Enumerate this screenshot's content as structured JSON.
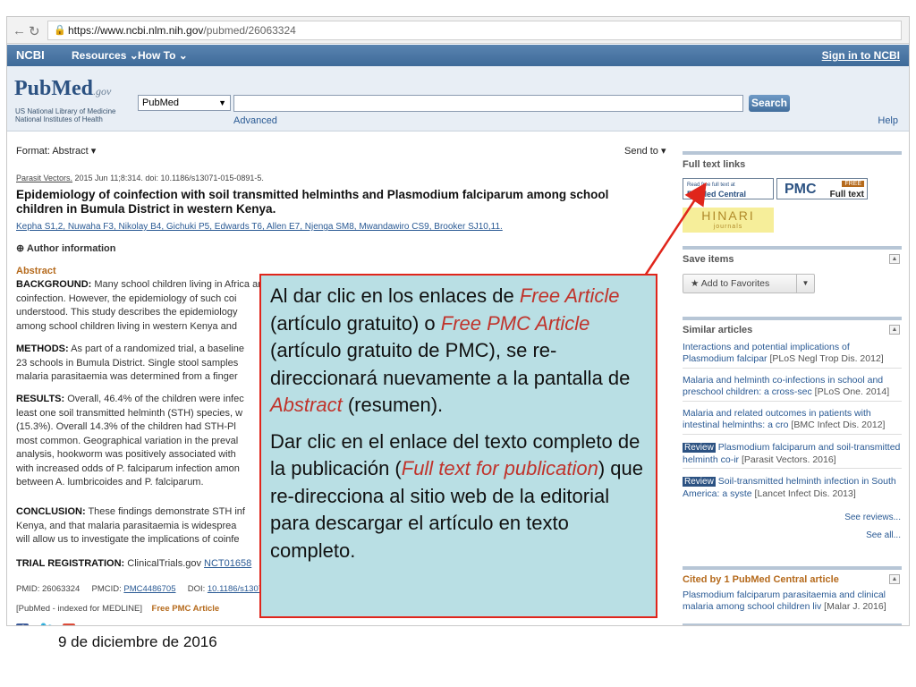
{
  "browser": {
    "url_base": "https://www.ncbi.nlm.nih.gov",
    "url_path": "/pubmed/26063324"
  },
  "ncbi": {
    "logo": "NCBI",
    "resources": "Resources",
    "howto": "How To",
    "signin": "Sign in to NCBI"
  },
  "search": {
    "logo_main": "PubMed",
    "logo_gov": ".gov",
    "nlm_line1": "US National Library of Medicine",
    "nlm_line2": "National Institutes of Health",
    "db": "PubMed",
    "button": "Search",
    "advanced": "Advanced",
    "help": "Help"
  },
  "article": {
    "format": "Format: Abstract",
    "sendto": "Send to",
    "journal": "Parasit Vectors.",
    "citation_rest": " 2015 Jun 11;8:314. doi: 10.1186/s13071-015-0891-5.",
    "title": "Epidemiology of coinfection with soil transmitted helminths and Plasmodium falciparum among school children in Bumula District in western Kenya.",
    "authors": "Kepha S1,2, Nuwaha F3, Nikolay B4, Gichuki P5, Edwards T6, Allen E7, Njenga SM8, Mwandawiro CS9, Brooker SJ10,11.",
    "author_info": "Author information",
    "abstract_heading": "Abstract",
    "background_label": "BACKGROUND:",
    "background_l1": " Many school children living in Africa are infected with plasmodia and helminth species and are consequently at risk of",
    "background_l2": "coinfection. However, the epidemiology of such coi",
    "background_l3": "understood. This study describes the epidemiology",
    "background_l4": "among school children living in western Kenya and",
    "methods_label": "METHODS:",
    "methods_l1": " As part of a randomized trial, a baseline",
    "methods_l2": "23 schools in Bumula District. Single stool samples",
    "methods_l3": "malaria parasitaemia was determined from a finger",
    "results_label": "RESULTS:",
    "results_l1": " Overall, 46.4% of the children were infec",
    "results_l2": "least one soil transmitted helminth (STH) species, w",
    "results_l3": "(15.3%). Overall 14.3% of the children had STH-Pl",
    "results_l4": "most common. Geographical variation in the preval",
    "results_l5": "analysis, hookworm was positively associated with",
    "results_l6": "with increased odds of P. falciparum infection amon",
    "results_l7": "between A. lumbricoides and P. falciparum.",
    "conclusion_label": "CONCLUSION:",
    "conclusion_l1": " These findings demonstrate STH inf",
    "conclusion_l2": "Kenya, and that malaria parasitaemia is widesprea",
    "conclusion_l3": "will allow us to investigate the implications of coinfe",
    "trial_label": "TRIAL REGISTRATION:",
    "trial_text": " ClinicalTrials.gov ",
    "trial_id": "NCT01658",
    "pmid": "PMID: 26063324",
    "pmcid_label": "PMCID: ",
    "pmcid": "PMC4486705",
    "doi_label": "DOI: ",
    "doi": "10.1186/s1307",
    "indexed": "[PubMed - indexed for MEDLINE]",
    "free_pmc": "Free PMC Article"
  },
  "sidebar": {
    "fulltext_heading": "Full text links",
    "biomed_l1": "Read free full text at",
    "biomed_l2": "BioMed Central",
    "pmc": "PMC",
    "pmc_free": "FREE",
    "pmc_ft": "Full text",
    "hinari": "HINARI",
    "hinari_sub": "journals",
    "save_heading": "Save items",
    "add_favorites": "Add to Favorites",
    "similar_heading": "Similar articles",
    "similar": [
      {
        "review": "",
        "text": "Interactions and potential implications of Plasmodium falcipar",
        "src": "[PLoS Negl Trop Dis. 2012]"
      },
      {
        "review": "",
        "text": "Malaria and helminth co-infections in school and preschool children: a cross-sec",
        "src": "[PLoS One. 2014]"
      },
      {
        "review": "",
        "text": "Malaria and related outcomes in patients with intestinal helminths: a cro",
        "src": "[BMC Infect Dis. 2012]"
      },
      {
        "review": "Review",
        "text": " Plasmodium falciparum and soil-transmitted helminth co-ir",
        "src": "[Parasit Vectors. 2016]"
      },
      {
        "review": "Review",
        "text": " Soil-transmitted helminth infection in South America: a syste",
        "src": "[Lancet Infect Dis. 2013]"
      }
    ],
    "see_reviews": "See reviews...",
    "see_all": "See all...",
    "cited_heading": "Cited by 1 PubMed Central article",
    "cited_text": "Plasmodium falciparum parasitaemia and clinical malaria among school children liv",
    "cited_src": "[Malar J. 2016]"
  },
  "callout": {
    "p1_a": "Al dar clic en los enlaces de ",
    "p1_em1": "Free Article",
    "p1_b": " (artículo gratuito) o ",
    "p1_em2": "Free PMC Article",
    "p1_c": " (artículo gratuito de PMC), se re-direccionará nuevamente a la pantalla de ",
    "p1_em3": "Abstract",
    "p1_d": " (resumen).",
    "p2_a": "Dar clic en el enlace del texto completo de la publicación (",
    "p2_em": "Full text for publication",
    "p2_b": ") que re-direcciona al sitio web de la editorial para descargar el artículo en texto completo."
  },
  "footer": {
    "date": "9 de diciembre de 2016"
  },
  "colors": {
    "callout_bg": "#b9dfe4",
    "callout_border": "#e0251b",
    "emphasis": "#c0332b",
    "ncbi_bar": "#3e6a99"
  }
}
